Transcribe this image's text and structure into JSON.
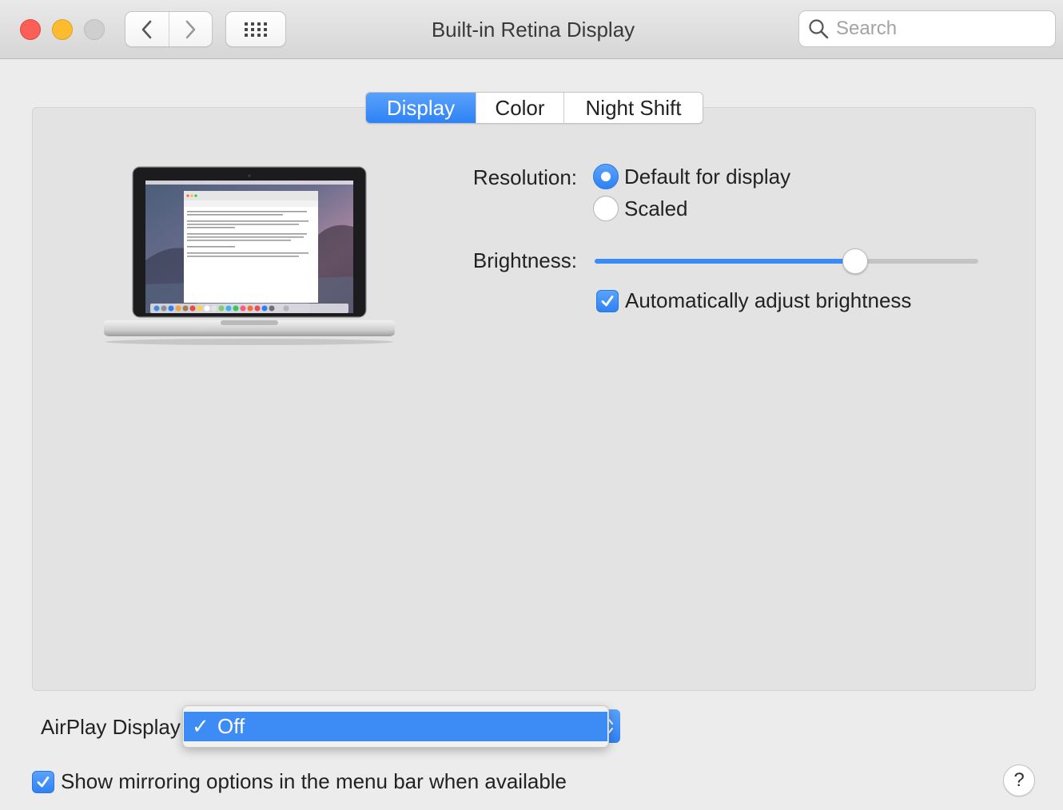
{
  "window": {
    "title": "Built-in Retina Display",
    "controls": [
      "close",
      "minimize",
      "zoom"
    ]
  },
  "toolbar": {
    "back_icon": "chevron-left-icon",
    "forward_icon": "chevron-right-icon",
    "show_all_icon": "grid-icon",
    "search_placeholder": "Search"
  },
  "tabs": [
    {
      "label": "Display",
      "active": true
    },
    {
      "label": "Color",
      "active": false
    },
    {
      "label": "Night Shift",
      "active": false
    }
  ],
  "display": {
    "resolution_label": "Resolution:",
    "resolution_options": [
      {
        "label": "Default for display",
        "selected": true
      },
      {
        "label": "Scaled",
        "selected": false
      }
    ],
    "brightness_label": "Brightness:",
    "brightness_value": 0.68,
    "auto_brightness_label": "Automatically adjust brightness",
    "auto_brightness_checked": true
  },
  "airplay": {
    "label": "AirPlay Display",
    "menu_items": [
      {
        "label": "Off",
        "checked": true,
        "check_mark": "✓"
      }
    ]
  },
  "mirroring": {
    "label": "Show mirroring options in the menu bar when available",
    "checked": true
  },
  "help": {
    "label": "?"
  },
  "colors": {
    "accent": "#3d8cf6",
    "close": "#fc5f57",
    "minimize": "#fdbc2e",
    "zoom_disabled": "#cfcfcf"
  }
}
